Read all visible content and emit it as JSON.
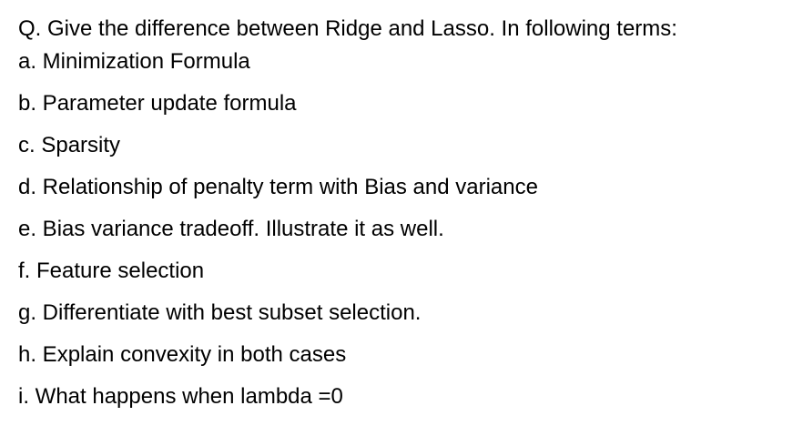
{
  "document": {
    "question": "Q. Give the difference between Ridge and Lasso. In following terms:",
    "items": [
      "a. Minimization Formula",
      "b. Parameter update formula",
      "c. Sparsity",
      "d. Relationship of penalty term with Bias and variance",
      "e. Bias variance tradeoff. Illustrate it as well.",
      "f. Feature selection",
      "g. Differentiate with best subset selection.",
      "h. Explain convexity in both cases",
      "i. What happens when lambda =0"
    ]
  }
}
